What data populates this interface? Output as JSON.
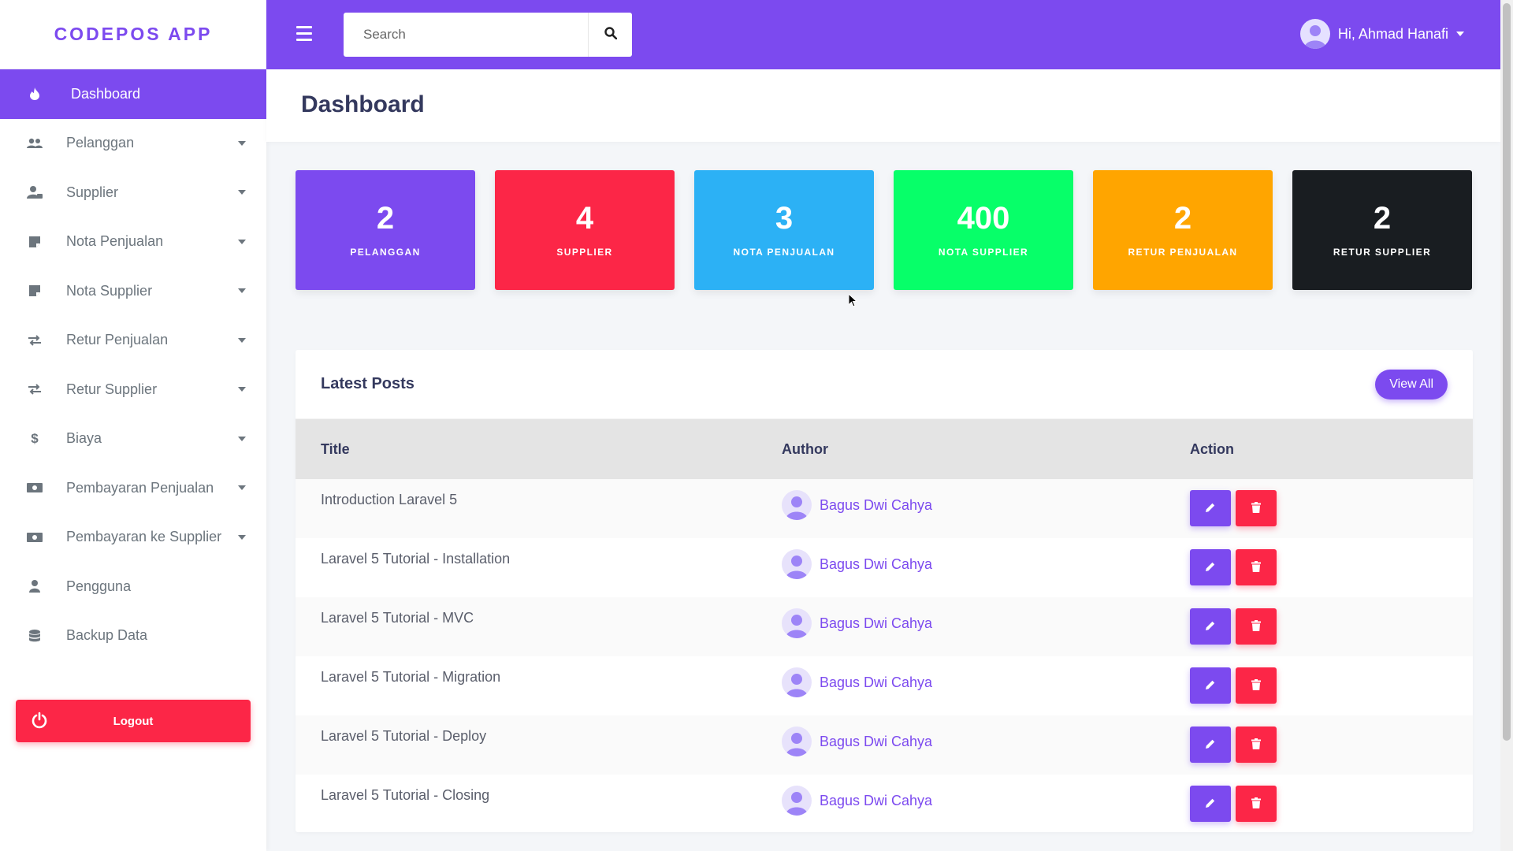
{
  "app": {
    "brand": "CODEPOS APP"
  },
  "sidebar": {
    "items": [
      {
        "label": "Dashboard",
        "icon": "fire-icon",
        "active": true
      },
      {
        "label": "Pelanggan",
        "icon": "users-icon"
      },
      {
        "label": "Supplier",
        "icon": "user-tie-icon"
      },
      {
        "label": "Nota Penjualan",
        "icon": "sticky-note-icon"
      },
      {
        "label": "Nota Supplier",
        "icon": "sticky-note-icon"
      },
      {
        "label": "Retur Penjualan",
        "icon": "exchange-icon"
      },
      {
        "label": "Retur Supplier",
        "icon": "exchange-icon"
      },
      {
        "label": "Biaya",
        "icon": "dollar-icon"
      },
      {
        "label": "Pembayaran Penjualan",
        "icon": "money-bill-icon"
      },
      {
        "label": "Pembayaran ke Supplier",
        "icon": "money-bill-icon"
      },
      {
        "label": "Pengguna",
        "icon": "user-icon"
      },
      {
        "label": "Backup Data",
        "icon": "database-icon"
      }
    ],
    "logout_label": "Logout"
  },
  "topbar": {
    "search_placeholder": "Search",
    "user_greeting": "Hi, Ahmad Hanafi"
  },
  "page": {
    "title": "Dashboard"
  },
  "stats": [
    {
      "value": "2",
      "label": "PELANGGAN",
      "color": "#7c4aef"
    },
    {
      "value": "4",
      "label": "SUPPLIER",
      "color": "#fc2647"
    },
    {
      "value": "3",
      "label": "NOTA PENJUALAN",
      "color": "#2cb1f5"
    },
    {
      "value": "400",
      "label": "NOTA SUPPLIER",
      "color": "#07ff69"
    },
    {
      "value": "2",
      "label": "RETUR PENJUALAN",
      "color": "#ffa500"
    },
    {
      "value": "2",
      "label": "RETUR SUPPLIER",
      "color": "#191d21"
    }
  ],
  "posts": {
    "title": "Latest Posts",
    "view_all": "View All",
    "columns": [
      "Title",
      "Author",
      "Action"
    ],
    "rows": [
      {
        "title": "Introduction Laravel 5",
        "author": "Bagus Dwi Cahya"
      },
      {
        "title": "Laravel 5 Tutorial - Installation",
        "author": "Bagus Dwi Cahya"
      },
      {
        "title": "Laravel 5 Tutorial - MVC",
        "author": "Bagus Dwi Cahya"
      },
      {
        "title": "Laravel 5 Tutorial - Migration",
        "author": "Bagus Dwi Cahya"
      },
      {
        "title": "Laravel 5 Tutorial - Deploy",
        "author": "Bagus Dwi Cahya"
      },
      {
        "title": "Laravel 5 Tutorial - Closing",
        "author": "Bagus Dwi Cahya"
      }
    ]
  }
}
